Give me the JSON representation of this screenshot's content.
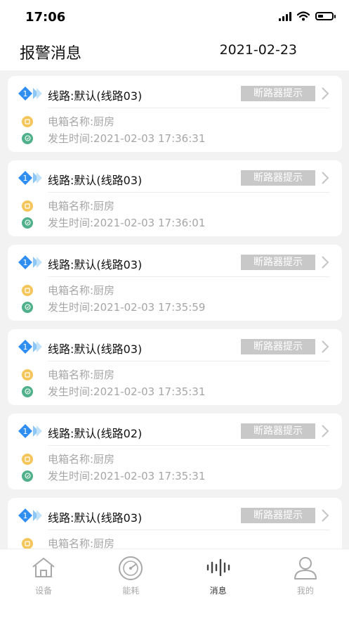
{
  "status_bar": {
    "time": "17:06"
  },
  "header": {
    "title": "报警消息",
    "date": "2021-02-23"
  },
  "alerts": [
    {
      "line": "线路:默认(线路03)",
      "tag": "断路器提示",
      "box_name": "电箱名称:厨房",
      "time": "发生时间:2021-02-03 17:36:31"
    },
    {
      "line": "线路:默认(线路03)",
      "tag": "断路器提示",
      "box_name": "电箱名称:厨房",
      "time": "发生时间:2021-02-03 17:36:01"
    },
    {
      "line": "线路:默认(线路03)",
      "tag": "断路器提示",
      "box_name": "电箱名称:厨房",
      "time": "发生时间:2021-02-03 17:35:59"
    },
    {
      "line": "线路:默认(线路03)",
      "tag": "断路器提示",
      "box_name": "电箱名称:厨房",
      "time": "发生时间:2021-02-03 17:35:31"
    },
    {
      "line": "线路:默认(线路02)",
      "tag": "断路器提示",
      "box_name": "电箱名称:厨房",
      "time": "发生时间:2021-02-03 17:35:31"
    },
    {
      "line": "线路:默认(线路03)",
      "tag": "断路器提示",
      "box_name": "电箱名称:厨房",
      "time": ""
    }
  ],
  "line_badge_number": "1",
  "tabs": [
    {
      "label": "设备",
      "icon": "home-icon"
    },
    {
      "label": "能耗",
      "icon": "gauge-icon"
    },
    {
      "label": "消息",
      "icon": "waveform-icon"
    },
    {
      "label": "我的",
      "icon": "user-icon"
    }
  ],
  "colors": {
    "badge_blue": "#2f8ef0",
    "tag_gray": "#c8c8c8",
    "dot_yellow": "#f4c55a",
    "dot_green": "#4fb08b"
  }
}
